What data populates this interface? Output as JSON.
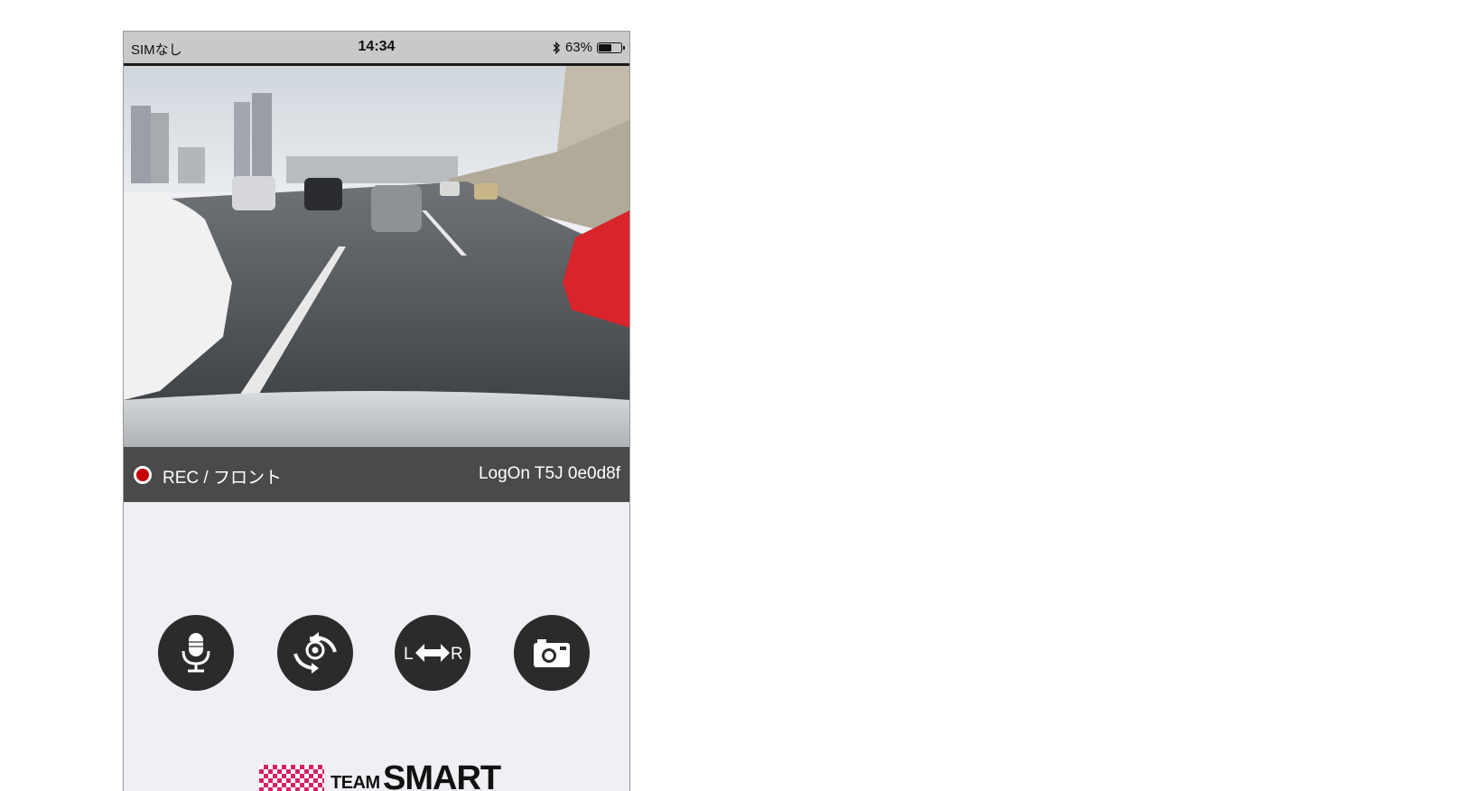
{
  "status_bar": {
    "carrier": "SIMなし",
    "time": "14:34",
    "bluetooth_icon": "bluetooth-icon",
    "battery_text": "63%",
    "battery_level": 0.63
  },
  "video": {
    "description_icon": "camera-feed-image"
  },
  "rec_bar": {
    "rec_label": "REC / フロント",
    "device_label": "LogOn T5J 0e0d8f",
    "rec_color": "#c40000"
  },
  "controls": {
    "mic_icon": "microphone-icon",
    "rotate_icon": "camera-rotate-icon",
    "lr_left": "L",
    "lr_right": "R",
    "snapshot_icon": "camera-icon"
  },
  "logo": {
    "team": "TEAM",
    "smart": "SMART"
  }
}
